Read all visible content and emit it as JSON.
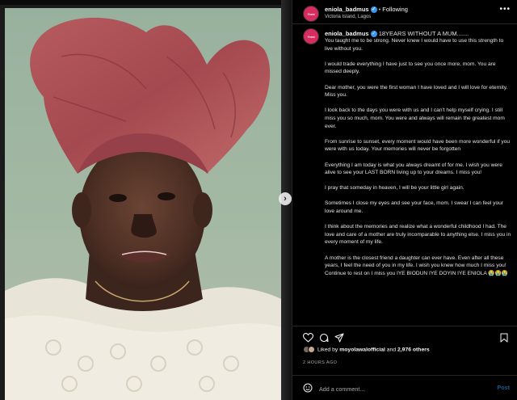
{
  "post": {
    "username": "eniola_badmus",
    "verified": true,
    "separator": "•",
    "follow_label": "Following",
    "location": "Victoria Island, Lagos",
    "avatar_text": "Yemi"
  },
  "caption": {
    "first_line": "18YEARS WITHOUT A MUM.......",
    "paragraphs": [
      "You taught me to be strong. Never knew I would have to use this strength to live without you.",
      "I would trade everything I have just to see you once more, mom. You are missed deeply.",
      "Dear mother, you were the first woman I have loved and I will love for eternity. Miss you.",
      "I look back to the days you were with us and I can't help myself crying. I still miss you so much, mom. You were and always will remain the greatest mom ever.",
      "From sunrise to sunset, every moment would have been more wonderful if you were with us today. Your memories will never be forgotten",
      "Everything I am today is what you always dreamt of for me. I wish you were alive to see your LAST BORN living up to your dreams. I miss you!",
      "I pray that someday in heaven, I will be your little girl again.",
      "Sometimes I close my eyes and see your face, mom. I swear I can feel your love around me.",
      "I think about the memories and realize what a wonderful childhood I had. The love and care of a mother are truly incomparable to anything else. I miss you in every moment of my life.",
      "A mother is the closest friend a daughter can ever have. Even after all these years, I feel the need of you in my life. I wish you knew how much I miss you! Continue to rest on I miss you IYE BIODUN IYE DOYIN IYE ENIOLA 😭😭😭"
    ]
  },
  "engagement": {
    "liked_by_prefix": "Liked by",
    "liked_by_user": "moyolawalofficial",
    "liked_by_and": "and",
    "others_label": "2,976 others",
    "timestamp": "2 HOURS AGO"
  },
  "comment": {
    "placeholder": "Add a comment...",
    "post_label": "Post"
  },
  "icons": {
    "more": "more-options-icon",
    "like": "heart-icon",
    "comment": "comment-icon",
    "share": "share-icon",
    "save": "bookmark-icon",
    "emoji": "emoji-icon",
    "next": "chevron-right-icon"
  },
  "colors": {
    "background": "#000000",
    "verified": "#3897f0",
    "avatar": "#d82b5f",
    "post_button": "#1d5a8c",
    "gele_headwrap": "#b0555a",
    "photo_backdrop": "#a3b9a3"
  }
}
